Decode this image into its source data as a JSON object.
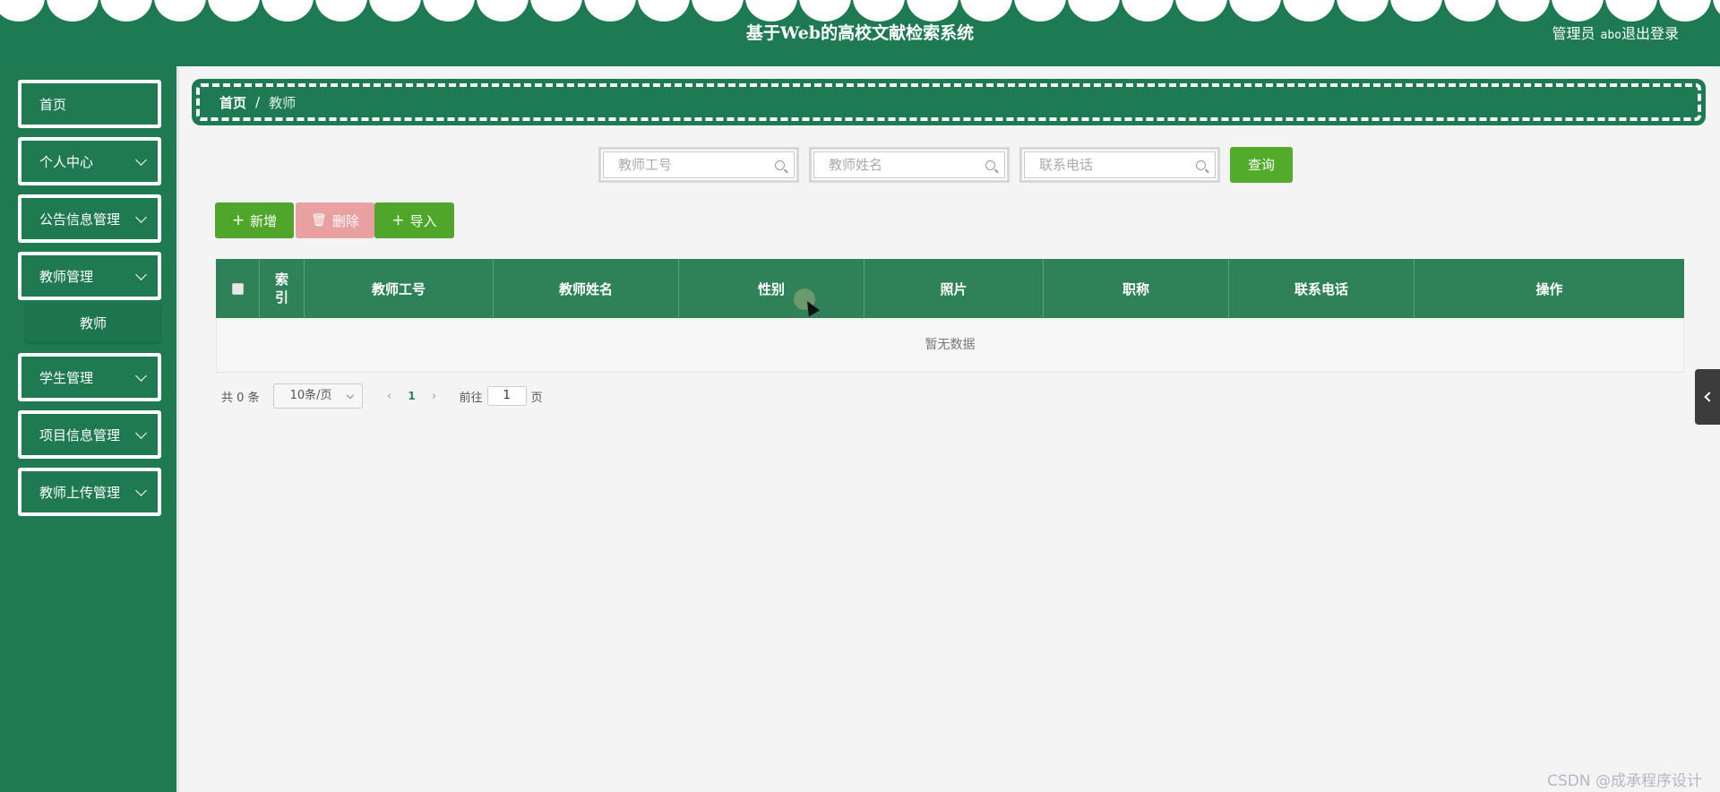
{
  "header": {
    "title": "基于Web的高校文献检索系统",
    "user_label": "管理员",
    "username": "abo",
    "logout": "退出登录"
  },
  "sidebar": {
    "items": [
      {
        "label": "首页",
        "has_chevron": false
      },
      {
        "label": "个人中心",
        "has_chevron": true
      },
      {
        "label": "公告信息管理",
        "has_chevron": true
      },
      {
        "label": "教师管理",
        "has_chevron": true
      },
      {
        "label": "学生管理",
        "has_chevron": true
      },
      {
        "label": "项目信息管理",
        "has_chevron": true
      },
      {
        "label": "教师上传管理",
        "has_chevron": true
      }
    ],
    "submenu": {
      "label": "教师"
    }
  },
  "breadcrumb": {
    "home": "首页",
    "separator": "/",
    "current": "教师"
  },
  "search": {
    "fields": [
      {
        "placeholder": "教师工号"
      },
      {
        "placeholder": "教师姓名"
      },
      {
        "placeholder": "联系电话"
      }
    ],
    "button": "查询"
  },
  "actions": {
    "add": "新增",
    "delete": "删除",
    "import": "导入"
  },
  "table": {
    "columns": [
      "索引",
      "教师工号",
      "教师姓名",
      "性别",
      "照片",
      "职称",
      "联系电话",
      "操作"
    ],
    "empty_text": "暂无数据"
  },
  "pagination": {
    "total_prefix": "共",
    "total": "0",
    "total_suffix": "条",
    "page_size": "10条/页",
    "current_page": "1",
    "goto_label": "前往",
    "goto_value": "1",
    "goto_suffix": "页"
  },
  "watermark": "CSDN @成承程序设计",
  "colors": {
    "primary": "#1e7a52",
    "header_table": "#2f8158",
    "button_green": "#4fa62a",
    "button_danger": "#e9a0a0"
  }
}
